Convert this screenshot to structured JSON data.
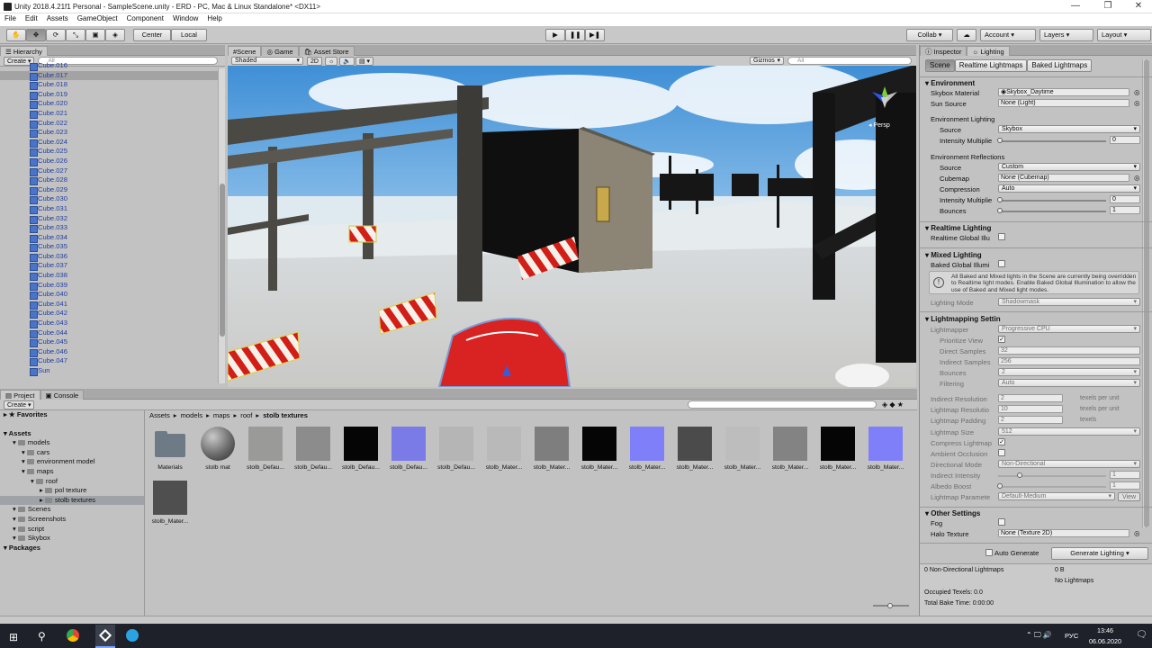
{
  "window": {
    "title": "Unity 2018.4.21f1 Personal - SampleScene.unity - ERD - PC, Mac & Linux Standalone* <DX11>"
  },
  "menu": [
    "File",
    "Edit",
    "Assets",
    "GameObject",
    "Component",
    "Window",
    "Help"
  ],
  "toolbar": {
    "center": "Center",
    "local": "Local",
    "collab": "Collab ▾",
    "account": "Account",
    "layers": "Layers",
    "layout": "Layout"
  },
  "hierarchy": {
    "tab": "Hierarchy",
    "create": "Create ▾",
    "search": "All",
    "items": [
      "Cube.016",
      "Cube.017",
      "Cube.018",
      "Cube.019",
      "Cube.020",
      "Cube.021",
      "Cube.022",
      "Cube.023",
      "Cube.024",
      "Cube.025",
      "Cube.026",
      "Cube.027",
      "Cube.028",
      "Cube.029",
      "Cube.030",
      "Cube.031",
      "Cube.032",
      "Cube.033",
      "Cube.034",
      "Cube.035",
      "Cube.036",
      "Cube.037",
      "Cube.038",
      "Cube.039",
      "Cube.040",
      "Cube.041",
      "Cube.042",
      "Cube.043",
      "Cube.044",
      "Cube.045",
      "Cube.046",
      "Cube.047",
      "Sun"
    ],
    "selected_index": 1,
    "last_item": "str"
  },
  "scene": {
    "tabs": [
      "Scene",
      "Game",
      "Asset Store"
    ],
    "shading": "Shaded",
    "mode2d": "2D",
    "gizmos": "Gizmos",
    "search": "All",
    "persp": "Persp"
  },
  "project": {
    "tabs": [
      "Project",
      "Console"
    ],
    "create": "Create ▾",
    "favorites": "Favorites",
    "tree": [
      {
        "label": "Assets",
        "depth": 0,
        "bold": true
      },
      {
        "label": "models",
        "depth": 1
      },
      {
        "label": "cars",
        "depth": 2
      },
      {
        "label": "environment model",
        "depth": 2
      },
      {
        "label": "maps",
        "depth": 2
      },
      {
        "label": "roof",
        "depth": 3
      },
      {
        "label": "pol texture",
        "depth": 4
      },
      {
        "label": "stolb textures",
        "depth": 4,
        "selected": true
      },
      {
        "label": "Scenes",
        "depth": 1
      },
      {
        "label": "Screenshots",
        "depth": 1
      },
      {
        "label": "script",
        "depth": 1
      },
      {
        "label": "Skybox",
        "depth": 1
      },
      {
        "label": "Packages",
        "depth": 0,
        "bold": true
      }
    ],
    "breadcrumb": [
      "Assets",
      "models",
      "maps",
      "roof",
      "stolb textures"
    ],
    "assets": [
      {
        "label": "Materials",
        "color": "#6e7a86",
        "kind": "folder"
      },
      {
        "label": "stolb mat",
        "color": "#6b6b6b",
        "kind": "sphere"
      },
      {
        "label": "stolb_Defau...",
        "color": "#9a9a98",
        "kind": "tex"
      },
      {
        "label": "stolb_Defau...",
        "color": "#8c8c8c",
        "kind": "tex"
      },
      {
        "label": "stolb_Defau...",
        "color": "#050505",
        "kind": "tex"
      },
      {
        "label": "stolb_Defau...",
        "color": "#7b7be8",
        "kind": "tex"
      },
      {
        "label": "stolb_Defau...",
        "color": "#b5b5b5",
        "kind": "tex"
      },
      {
        "label": "stolb_Mater...",
        "color": "#b9b9b9",
        "kind": "tex"
      },
      {
        "label": "stolb_Mater...",
        "color": "#7e7e7e",
        "kind": "tex"
      },
      {
        "label": "stolb_Mater...",
        "color": "#050505",
        "kind": "tex"
      },
      {
        "label": "stolb_Mater...",
        "color": "#7f7ffa",
        "kind": "tex"
      },
      {
        "label": "stolb_Mater...",
        "color": "#4b4b4b",
        "kind": "tex"
      },
      {
        "label": "stolb_Mater...",
        "color": "#bdbdbd",
        "kind": "tex"
      },
      {
        "label": "stolb_Mater...",
        "color": "#838383",
        "kind": "tex"
      },
      {
        "label": "stolb_Mater...",
        "color": "#050505",
        "kind": "tex"
      },
      {
        "label": "stolb_Mater...",
        "color": "#7f7ffa",
        "kind": "tex"
      },
      {
        "label": "stolb_Mater...",
        "color": "#4f4f4f",
        "kind": "tex"
      }
    ]
  },
  "inspector": {
    "tabs": [
      "Inspector",
      "Lighting"
    ],
    "subtabs": [
      "Scene",
      "Realtime Lightmaps",
      "Baked Lightmaps"
    ],
    "environment": {
      "title": "Environment",
      "skybox_label": "Skybox Material",
      "skybox_value": "Skybox_Daytime",
      "sun_label": "Sun Source",
      "sun_value": "None (Light)",
      "env_lighting": "Environment Lighting",
      "source_label": "Source",
      "source_value": "Skybox",
      "intensity_label": "Intensity Multiplie",
      "intensity_value": "0",
      "env_reflections": "Environment Reflections",
      "refl_source_label": "Source",
      "refl_source_value": "Custom",
      "cubemap_label": "Cubemap",
      "cubemap_value": "None (Cubemap)",
      "compression_label": "Compression",
      "compression_value": "Auto",
      "refl_intensity_label": "Intensity Multiplie",
      "refl_intensity_value": "0",
      "bounces_label": "Bounces",
      "bounces_value": "1"
    },
    "realtime": {
      "title": "Realtime Lighting",
      "gi_label": "Realtime Global Illu"
    },
    "mixed": {
      "title": "Mixed Lighting",
      "baked_label": "Baked Global Illumi",
      "info": "All Baked and Mixed lights in the Scene are currently being overridden to Realtime light modes. Enable Baked Global Illumination to allow the use of Baked and Mixed light modes.",
      "mode_label": "Lighting Mode",
      "mode_value": "Shadowmask"
    },
    "lightmapping": {
      "title": "Lightmapping Settin",
      "rows": [
        {
          "label": "Lightmapper",
          "value": "Progressive CPU",
          "type": "dropdown"
        },
        {
          "label": "Prioritize View",
          "value": "✓",
          "type": "check"
        },
        {
          "label": "Direct Samples",
          "value": "32",
          "type": "field"
        },
        {
          "label": "Indirect Samples",
          "value": "256",
          "type": "field"
        },
        {
          "label": "Bounces",
          "value": "2",
          "type": "dropdown"
        },
        {
          "label": "Filtering",
          "value": "Auto",
          "type": "dropdown"
        }
      ],
      "rows2": [
        {
          "label": "Indirect Resolution",
          "value": "2",
          "unit": "texels per unit"
        },
        {
          "label": "Lightmap Resolutio",
          "value": "10",
          "unit": "texels per unit"
        },
        {
          "label": "Lightmap Padding",
          "value": "2",
          "unit": "texels"
        }
      ],
      "size_label": "Lightmap Size",
      "size_value": "512",
      "compress_label": "Compress Lightmap",
      "ao_label": "Ambient Occlusion",
      "dir_label": "Directional Mode",
      "dir_value": "Non-Directional",
      "indirect_label": "Indirect Intensity",
      "indirect_value": "1",
      "albedo_label": "Albedo Boost",
      "albedo_value": "1",
      "params_label": "Lightmap Paramete",
      "params_value": "Default-Medium",
      "view_button": "View"
    },
    "other": {
      "title": "Other Settings",
      "fog_label": "Fog",
      "halo_label": "Halo Texture",
      "halo_value": "None (Texture 2D)"
    },
    "auto_generate": "Auto Generate",
    "generate_button": "Generate Lighting",
    "stats": {
      "lightmaps": "0 Non-Directional Lightmaps",
      "size": "0 B",
      "none": "No Lightmaps",
      "texels": "Occupied Texels: 0.0",
      "bake_time": "Total Bake Time: 0:00:00"
    }
  },
  "taskbar": {
    "lang": "РУС",
    "time": "13:46",
    "date": "06.06.2020"
  }
}
